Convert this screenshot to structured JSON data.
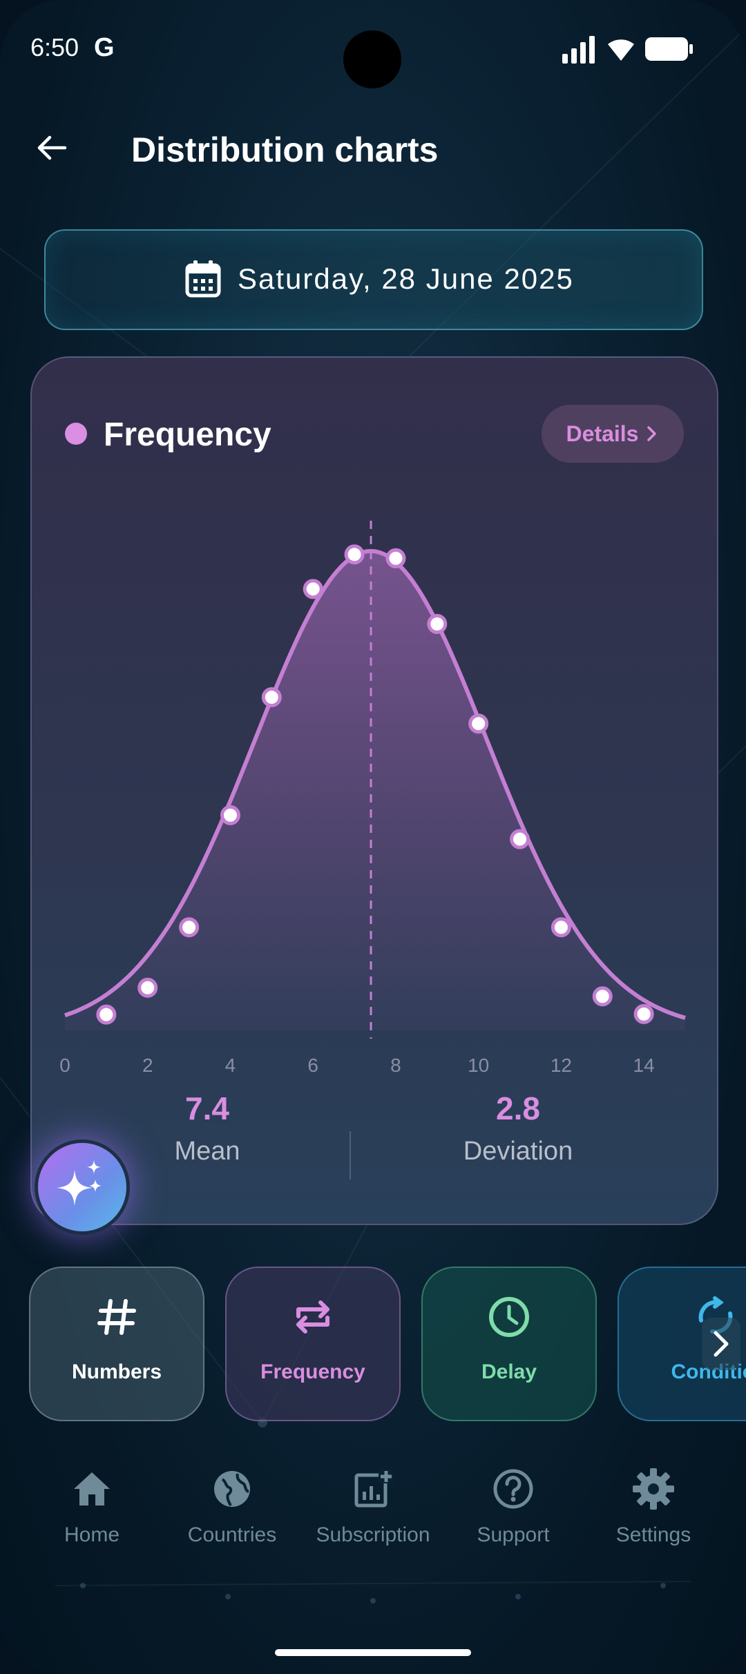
{
  "status_bar": {
    "time": "6:50",
    "google_letter": "G"
  },
  "header": {
    "title": "Distribution charts"
  },
  "date_selector": {
    "label": "Saturday, 28 June 2025"
  },
  "card": {
    "title": "Frequency",
    "details_label": "Details",
    "accent_color": "#da8fe2"
  },
  "stats": {
    "mean_value": "7.4",
    "mean_label": "Mean",
    "deviation_value": "2.8",
    "deviation_label": "Deviation"
  },
  "chart_data": {
    "type": "line",
    "x_ticks": [
      0,
      2,
      4,
      6,
      8,
      10,
      12,
      14
    ],
    "xlim": [
      0,
      15
    ],
    "mean_line_x": 7.4,
    "curve": {
      "mean": 7.4,
      "std": 2.8
    },
    "points": [
      {
        "x": 1,
        "y": 0.033
      },
      {
        "x": 2,
        "y": 0.089
      },
      {
        "x": 3,
        "y": 0.215
      },
      {
        "x": 4,
        "y": 0.449
      },
      {
        "x": 5,
        "y": 0.695
      },
      {
        "x": 6,
        "y": 0.921
      },
      {
        "x": 7,
        "y": 0.993
      },
      {
        "x": 8,
        "y": 0.985
      },
      {
        "x": 9,
        "y": 0.848
      },
      {
        "x": 10,
        "y": 0.64
      },
      {
        "x": 11,
        "y": 0.399
      },
      {
        "x": 12,
        "y": 0.215
      },
      {
        "x": 13,
        "y": 0.071
      },
      {
        "x": 14,
        "y": 0.034
      }
    ],
    "grid": false
  },
  "filters": [
    {
      "label": "Numbers",
      "icon": "hash-icon"
    },
    {
      "label": "Frequency",
      "icon": "repeat-icon"
    },
    {
      "label": "Delay",
      "icon": "clock-icon"
    },
    {
      "label": "Conditional",
      "icon": "conditional-icon"
    }
  ],
  "nav": [
    {
      "label": "Home",
      "icon": "home-icon"
    },
    {
      "label": "Countries",
      "icon": "globe-icon"
    },
    {
      "label": "Subscription",
      "icon": "chart-add-icon"
    },
    {
      "label": "Support",
      "icon": "help-icon"
    },
    {
      "label": "Settings",
      "icon": "gear-icon"
    }
  ]
}
